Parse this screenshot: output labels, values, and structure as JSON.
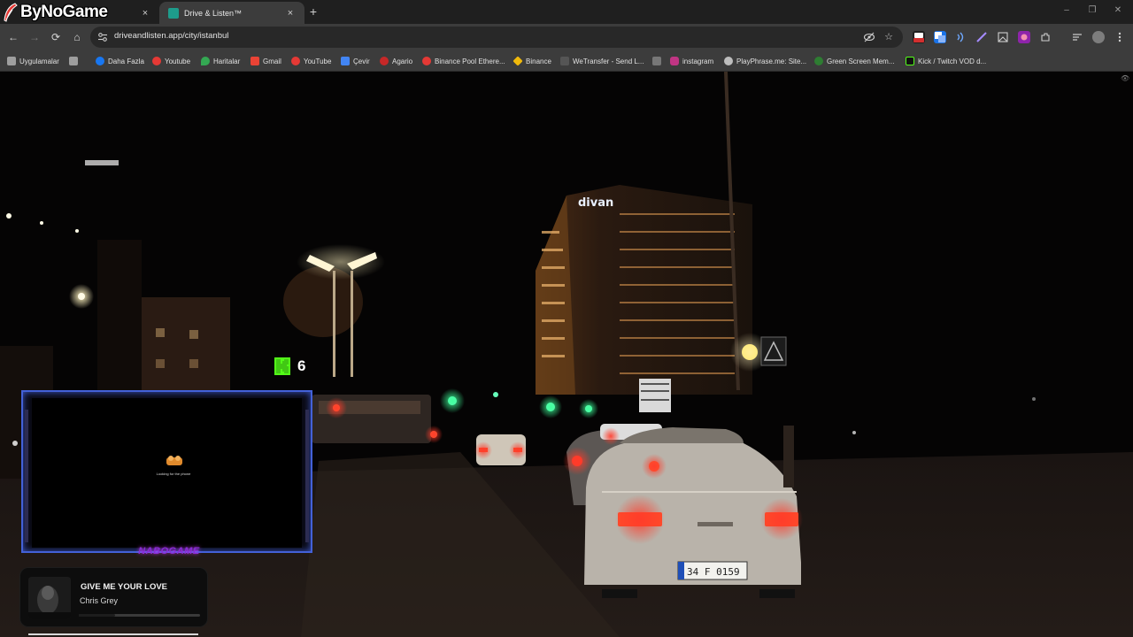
{
  "overlay_logo": {
    "text": "ByNoGame"
  },
  "tabs": [
    {
      "title": "",
      "active": false,
      "close_label": "×"
    },
    {
      "title": "Drive & Listen™",
      "active": true,
      "close_label": "×"
    }
  ],
  "new_tab_label": "+",
  "window_controls": {
    "minimize": "–",
    "restore": "❐",
    "close": "✕"
  },
  "toolbar": {
    "back": "←",
    "forward": "→",
    "reload": "⟳",
    "home": "⌂",
    "url": "driveandlisten.app/city/istanbul"
  },
  "extensions": [
    {
      "name": "new-extension-icon",
      "label": "New",
      "color": "#d32f2f"
    },
    {
      "name": "translate-extension-icon",
      "label": "文",
      "color": "#1a73e8"
    },
    {
      "name": "audio-extension-icon",
      "label": "))",
      "color": "#3c3c3c"
    },
    {
      "name": "feather-extension-icon",
      "label": "/",
      "color": "#3c3c3c"
    },
    {
      "name": "screenshot-extension-icon",
      "label": "▣",
      "color": "#3c3c3c"
    },
    {
      "name": "puzzle-extension-icon",
      "label": "◈",
      "color": "#9c27b0"
    },
    {
      "name": "extensions-menu-icon",
      "label": "⧉",
      "color": "#3c3c3c"
    }
  ],
  "bookmarks": [
    {
      "label": "Uygulamalar",
      "icon": "apps-grid-icon",
      "color": "#9e9e9e"
    },
    {
      "label": "",
      "icon": "grid-icon",
      "color": "#9e9e9e"
    },
    {
      "label": "Daha Fazla",
      "icon": "facebook-icon",
      "color": "#1877f2"
    },
    {
      "label": "Youtube",
      "icon": "youtube-icon",
      "color": "#e53935"
    },
    {
      "label": "Haritalar",
      "icon": "maps-icon",
      "color": "#34a853"
    },
    {
      "label": "Gmail",
      "icon": "gmail-icon",
      "color": "#ea4335"
    },
    {
      "label": "YouTube",
      "icon": "youtube-icon",
      "color": "#e53935"
    },
    {
      "label": "Çevir",
      "icon": "translate-icon",
      "color": "#4285f4"
    },
    {
      "label": "Agario",
      "icon": "agario-icon",
      "color": "#c62828"
    },
    {
      "label": "Binance Pool Ethere...",
      "icon": "youtube-icon",
      "color": "#e53935"
    },
    {
      "label": "Binance",
      "icon": "binance-icon",
      "color": "#f0b90b"
    },
    {
      "label": "WeTransfer - Send L...",
      "icon": "wetransfer-icon",
      "color": "#555555"
    },
    {
      "label": "",
      "icon": "printer-icon",
      "color": "#777777"
    },
    {
      "label": "instagram",
      "icon": "instagram-icon",
      "color": "#c13584"
    },
    {
      "label": "PlayPhrase.me: Site...",
      "icon": "playphrase-icon",
      "color": "#bdbdbd"
    },
    {
      "label": "Green Screen Mem...",
      "icon": "green-screen-icon",
      "color": "#2e7d32"
    },
    {
      "label": "Kick / Twitch VOD d...",
      "icon": "kick-d-icon",
      "color": "#53fc18"
    }
  ],
  "stream_overlay": {
    "kick_viewer_count": "6",
    "webcam_status": "Looking for the phone",
    "webcam_brand": "NABOGAME"
  },
  "now_playing": {
    "title": "GIVE ME YOUR LOVE",
    "artist": "Chris Grey",
    "progress": 0.3
  },
  "scene": {
    "building_sign": "divan",
    "small_sign": "YÜRÜDELER",
    "plate": "34 F 0159"
  }
}
